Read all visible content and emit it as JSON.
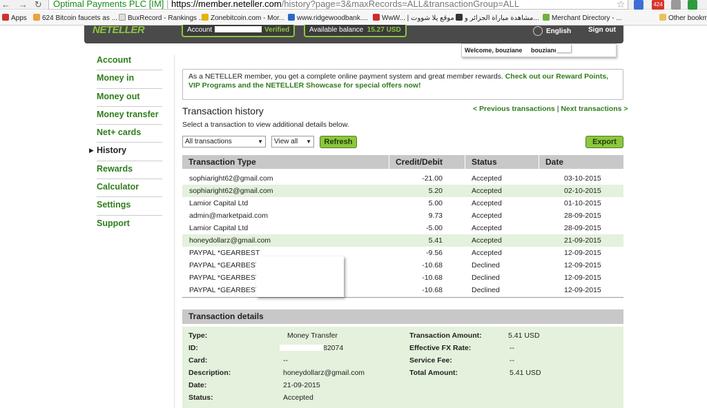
{
  "browser": {
    "url_secure": "Optimal Payments PLC [IM]",
    "url_host": "https://member.neteller.com",
    "url_path": "/history?page=3&maxRecords=ALL&transactionGroup=ALL",
    "ext_badge": "424",
    "bookmarks": [
      "Apps",
      "624 Bitcoin faucets as ...",
      "BuxRecord - Rankings ...",
      "Zonebitcoin.com - Mor...",
      "www.ridgewoodbank....",
      "WwW... | موقع يلا شووت",
      "مشاهدة مباراة الجزائر و...",
      "Merchant Directory - ...",
      "Other bookmarks"
    ]
  },
  "header": {
    "logo": "NETELLER",
    "account_label": "Account",
    "verified": "Verified",
    "balance_label": "Available balance",
    "balance_value": "15.27 USD",
    "language": "English",
    "signout": "Sign out",
    "welcome": "Welcome, bouziane",
    "welcome_user": "bouzianei"
  },
  "sidebar": {
    "items": [
      "Account",
      "Money in",
      "Money out",
      "Money transfer",
      "Net+ cards",
      "History",
      "Rewards",
      "Calculator",
      "Settings",
      "Support"
    ],
    "active": "History"
  },
  "promo": {
    "text": "As a NETELLER member, you get a complete online payment system and great member rewards.",
    "link": "Check out our Reward Points, VIP Programs and the NETELLER Showcase for special offers now!"
  },
  "history": {
    "title": "Transaction history",
    "prev": "< Previous transactions",
    "next": "Next transactions >",
    "hint": "Select a transaction to view additional details below.",
    "filter_type": "All transactions",
    "filter_view": "View all",
    "refresh": "Refresh",
    "export": "Export",
    "columns": [
      "Transaction Type",
      "Credit/Debit",
      "Status",
      "Date"
    ],
    "rows": [
      {
        "type": "sophiaright62@gmail.com",
        "amount": "-21.00",
        "status": "Accepted",
        "date": "03-10-2015",
        "hl": false
      },
      {
        "type": "sophiaright62@gmail.com",
        "amount": "5.20",
        "status": "Accepted",
        "date": "02-10-2015",
        "hl": true
      },
      {
        "type": "Lamior Capital Ltd",
        "amount": "5.00",
        "status": "Accepted",
        "date": "01-10-2015",
        "hl": false
      },
      {
        "type": "admin@marketpaid.com",
        "amount": "9.73",
        "status": "Accepted",
        "date": "28-09-2015",
        "hl": false
      },
      {
        "type": "Lamior Capital Ltd",
        "amount": "-5.00",
        "status": "Accepted",
        "date": "28-09-2015",
        "hl": false
      },
      {
        "type": "honeydollarz@gmail.com",
        "amount": "5.41",
        "status": "Accepted",
        "date": "21-09-2015",
        "hl": true
      },
      {
        "type": "PAYPAL *GEARBEST",
        "amount": "-9.56",
        "status": "Accepted",
        "date": "12-09-2015",
        "hl": false
      },
      {
        "type": "PAYPAL *GEARBEST",
        "amount": "-10.68",
        "status": "Declined",
        "date": "12-09-2015",
        "hl": false
      },
      {
        "type": "PAYPAL *GEARBEST",
        "amount": "-10.68",
        "status": "Declined",
        "date": "12-09-2015",
        "hl": false
      },
      {
        "type": "PAYPAL *GEARBEST",
        "amount": "-10.68",
        "status": "Declined",
        "date": "12-09-2015",
        "hl": false
      }
    ]
  },
  "details": {
    "title": "Transaction details",
    "type_label": "Type:",
    "type": "Money Transfer",
    "id_label": "ID:",
    "id": "82074",
    "card_label": "Card:",
    "card": "--",
    "desc_label": "Description:",
    "desc": "honeydollarz@gmail.com",
    "date_label": "Date:",
    "date": "21-09-2015",
    "status_label": "Status:",
    "status": "Accepted",
    "amount_label": "Transaction Amount:",
    "amount": "5.41 USD",
    "fx_label": "Effective FX Rate:",
    "fx": "--",
    "fee_label": "Service Fee:",
    "fee": "--",
    "total_label": "Total Amount:",
    "total": "5.41 USD"
  },
  "colors": {
    "accent": "#8dc63f",
    "link": "#2e7d1b",
    "header": "#4a4a4a",
    "row_highlight": "#e4f1dc"
  }
}
